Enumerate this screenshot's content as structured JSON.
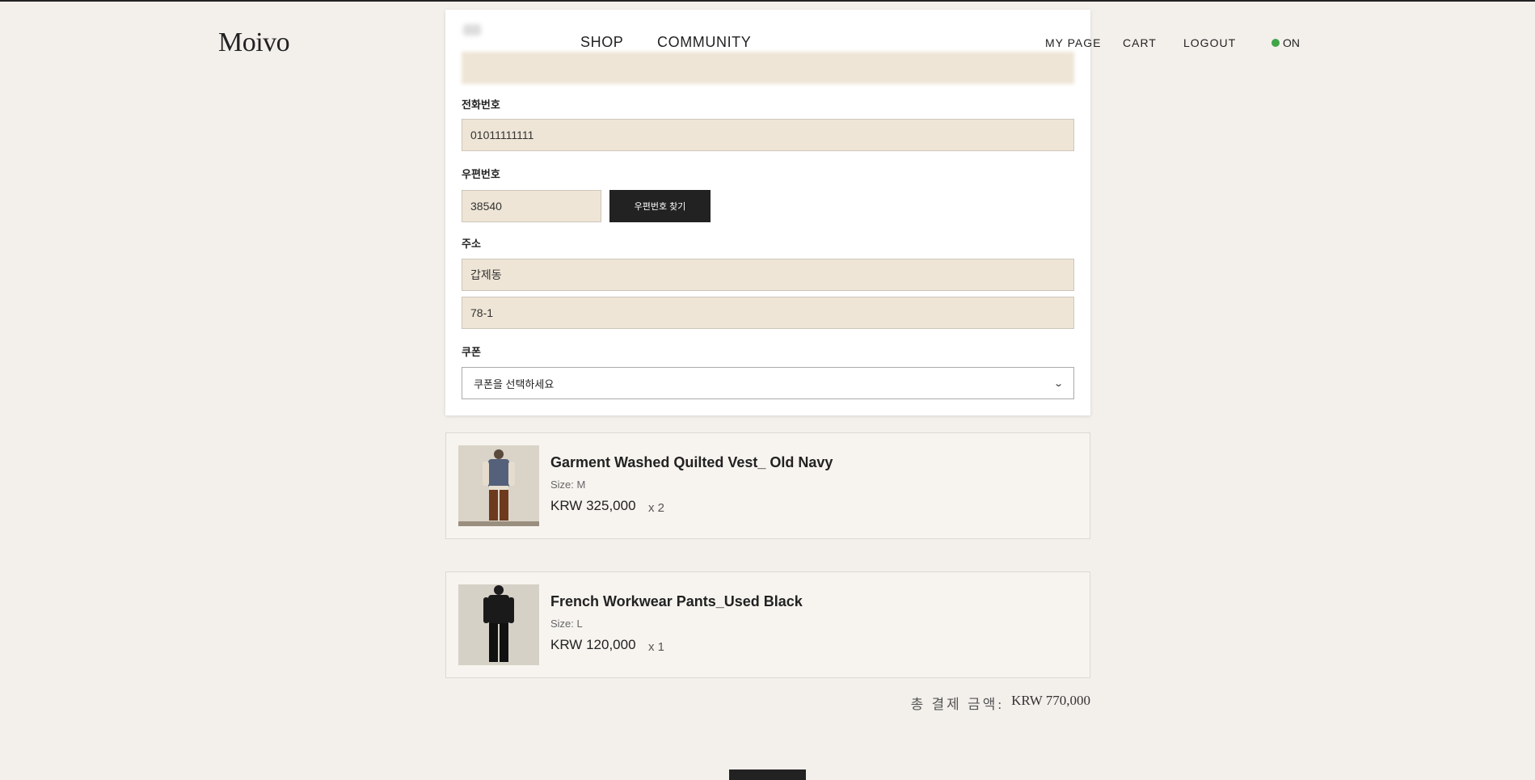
{
  "header": {
    "logo": "Moivo",
    "nav": {
      "shop": "SHOP",
      "community": "COMMUNITY"
    },
    "right": {
      "mypage": "MY PAGE",
      "cart": "CART",
      "logout": "LOGOUT"
    },
    "status": {
      "label": "ON",
      "color": "#3fa547"
    }
  },
  "form": {
    "phone": {
      "label": "전화번호",
      "value": "01011111111"
    },
    "zipcode": {
      "label": "우편번호",
      "value": "38540",
      "button": "우편번호 찾기"
    },
    "address": {
      "label": "주소",
      "line1": "갑제동",
      "line2": "78-1"
    },
    "coupon": {
      "label": "쿠폰",
      "placeholder": "쿠폰을 선택하세요"
    }
  },
  "cart_items": [
    {
      "name": "Garment Washed Quilted Vest_ Old Navy",
      "size": "Size: M",
      "price": "KRW 325,000",
      "qty": "x 2"
    },
    {
      "name": "French Workwear Pants_Used Black",
      "size": "Size: L",
      "price": "KRW 120,000",
      "qty": "x 1"
    }
  ],
  "total": {
    "label": "총 결제 금액:",
    "value": "KRW 770,000"
  },
  "colors": {
    "background": "#f3f0ec",
    "input_fill": "#eee5d6",
    "button": "#222222"
  }
}
